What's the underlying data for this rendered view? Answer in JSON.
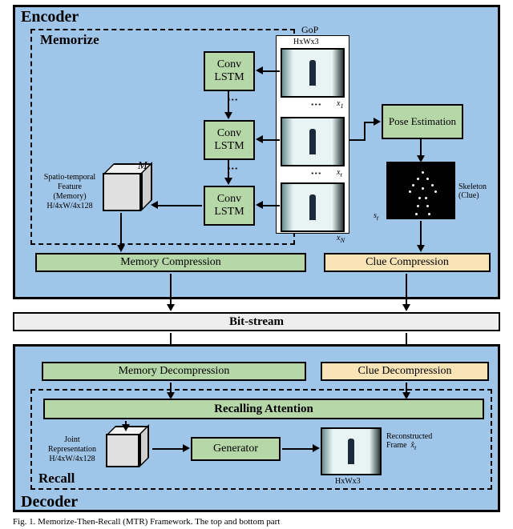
{
  "encoder": {
    "title": "Encoder",
    "memorize_label": "Memorize",
    "convlstm": "Conv LSTM",
    "gop_label": "GoP",
    "gop_dim": "HxWx3",
    "x1": "x",
    "x1_sub": "1",
    "xt": "x",
    "xt_sub": "t",
    "xN": "x",
    "xN_sub": "N",
    "pose": "Pose Estimation",
    "clue_label": "Skeleton (Clue)",
    "st": "s",
    "st_sub": "t",
    "mem_feat1": "Spatio-temporal",
    "mem_feat2": "Feature",
    "mem_feat3": "(Memory)",
    "mem_feat4": "H/4xW/4x128",
    "M": "M",
    "mem_comp": "Memory Compression",
    "clue_comp": "Clue Compression"
  },
  "bitstream": "Bit-stream",
  "decoder": {
    "title": "Decoder",
    "mem_decomp": "Memory Decompression",
    "clue_decomp": "Clue Decompression",
    "recall_attn": "Recalling Attention",
    "joint1": "Joint",
    "joint2": "Representation",
    "joint3": "H/4xW/4x128",
    "generator": "Generator",
    "rec1": "Reconstructed",
    "rec2": "Frame",
    "xhat": "x̂",
    "xhat_sub": "t",
    "rec_dim": "HxWx3",
    "recall_label": "Recall"
  },
  "caption": "Fig. 1.   Memorize-Then-Recall (MTR) Framework. The top and bottom part"
}
